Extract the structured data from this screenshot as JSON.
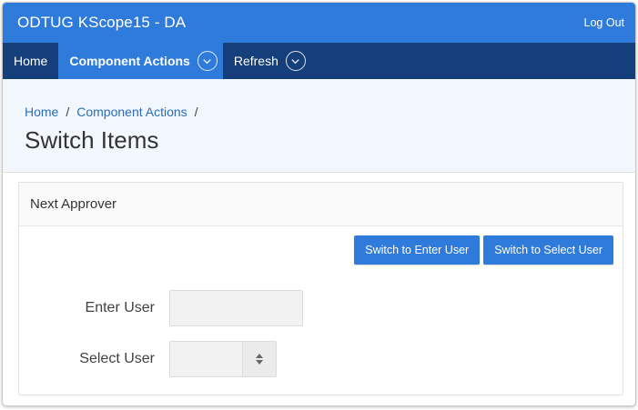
{
  "app": {
    "title": "ODTUG KScope15 - DA",
    "logout_label": "Log Out",
    "accent_color": "#2f7bdb",
    "nav_color": "#143f7a"
  },
  "nav": {
    "items": [
      {
        "label": "Home",
        "active": false,
        "has_menu": false
      },
      {
        "label": "Component Actions",
        "active": true,
        "has_menu": true,
        "icon": "chevron-down-icon"
      },
      {
        "label": "Refresh",
        "active": false,
        "has_menu": true,
        "icon": "chevron-down-icon"
      }
    ]
  },
  "breadcrumb": {
    "items": [
      "Home",
      "Component Actions"
    ],
    "separator": "/"
  },
  "page": {
    "title": "Switch Items"
  },
  "region": {
    "title": "Next Approver",
    "buttons": {
      "enter_user": "Switch to Enter User",
      "select_user": "Switch to Select User"
    },
    "fields": {
      "enter_user_label": "Enter User",
      "enter_user_value": "",
      "select_user_label": "Select User",
      "select_user_value": "",
      "select_icon": "up-down-arrows-icon"
    }
  }
}
